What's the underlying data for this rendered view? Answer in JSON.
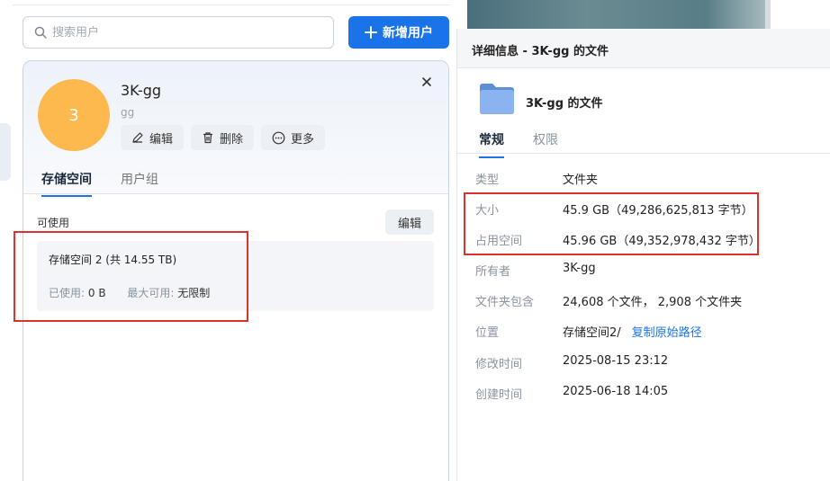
{
  "search": {
    "placeholder": "搜索用户"
  },
  "add_button": {
    "label": "新增用户"
  },
  "user": {
    "avatar_letter": "3",
    "name": "3K-gg",
    "subtitle": "gg",
    "actions": [
      {
        "label": "编辑",
        "icon": "pencil-icon"
      },
      {
        "label": "删除",
        "icon": "trash-icon"
      },
      {
        "label": "更多",
        "icon": "more-icon"
      }
    ],
    "tabs": [
      "存储空间",
      "用户组"
    ],
    "available_label": "可使用",
    "edit_label": "编辑",
    "storage": {
      "name": "存储空间 2 (共 14.55 TB)",
      "used_label": "已使用:",
      "used_value": "0 B",
      "max_label": "最大可用:",
      "max_value": "无限制"
    }
  },
  "panel": {
    "title": "详细信息 - 3K-gg 的文件",
    "folder_name": "3K-gg 的文件",
    "tabs": [
      "常规",
      "权限"
    ],
    "rows": [
      {
        "key": "类型",
        "value": "文件夹"
      },
      {
        "key": "大小",
        "value": "45.9 GB（49,286,625,813 字节）"
      },
      {
        "key": "占用空间",
        "value": "45.96 GB（49,352,978,432 字节）"
      },
      {
        "key": "所有者",
        "value": "3K-gg"
      },
      {
        "key": "文件夹包含",
        "value": "24,608 个文件， 2,908 个文件夹"
      },
      {
        "key": "位置",
        "value": "存储空间2/",
        "link": "复制原始路径"
      },
      {
        "key": "修改时间",
        "value": "2025-08-15 23:12"
      },
      {
        "key": "创建时间",
        "value": "2025-06-18 14:05"
      }
    ]
  },
  "colors": {
    "accent": "#1a73e8",
    "avatar": "#fdb94e",
    "highlight": "#d9332b"
  }
}
